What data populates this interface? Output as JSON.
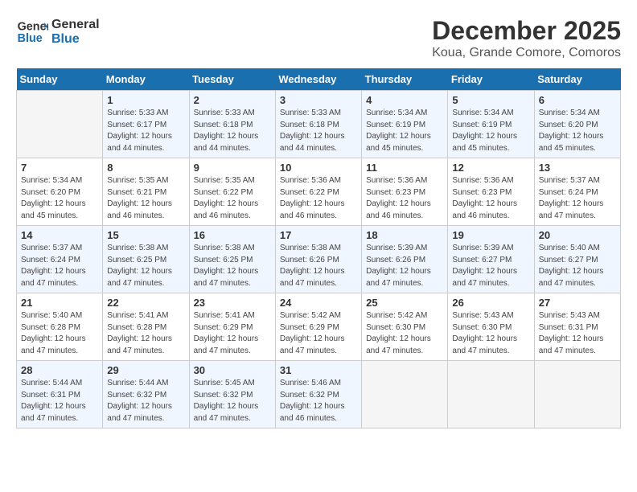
{
  "logo": {
    "line1": "General",
    "line2": "Blue"
  },
  "title": "December 2025",
  "subtitle": "Koua, Grande Comore, Comoros",
  "days_of_week": [
    "Sunday",
    "Monday",
    "Tuesday",
    "Wednesday",
    "Thursday",
    "Friday",
    "Saturday"
  ],
  "weeks": [
    [
      {
        "day": "",
        "info": ""
      },
      {
        "day": "1",
        "info": "Sunrise: 5:33 AM\nSunset: 6:17 PM\nDaylight: 12 hours\nand 44 minutes."
      },
      {
        "day": "2",
        "info": "Sunrise: 5:33 AM\nSunset: 6:18 PM\nDaylight: 12 hours\nand 44 minutes."
      },
      {
        "day": "3",
        "info": "Sunrise: 5:33 AM\nSunset: 6:18 PM\nDaylight: 12 hours\nand 44 minutes."
      },
      {
        "day": "4",
        "info": "Sunrise: 5:34 AM\nSunset: 6:19 PM\nDaylight: 12 hours\nand 45 minutes."
      },
      {
        "day": "5",
        "info": "Sunrise: 5:34 AM\nSunset: 6:19 PM\nDaylight: 12 hours\nand 45 minutes."
      },
      {
        "day": "6",
        "info": "Sunrise: 5:34 AM\nSunset: 6:20 PM\nDaylight: 12 hours\nand 45 minutes."
      }
    ],
    [
      {
        "day": "7",
        "info": "Sunrise: 5:34 AM\nSunset: 6:20 PM\nDaylight: 12 hours\nand 45 minutes."
      },
      {
        "day": "8",
        "info": "Sunrise: 5:35 AM\nSunset: 6:21 PM\nDaylight: 12 hours\nand 46 minutes."
      },
      {
        "day": "9",
        "info": "Sunrise: 5:35 AM\nSunset: 6:22 PM\nDaylight: 12 hours\nand 46 minutes."
      },
      {
        "day": "10",
        "info": "Sunrise: 5:36 AM\nSunset: 6:22 PM\nDaylight: 12 hours\nand 46 minutes."
      },
      {
        "day": "11",
        "info": "Sunrise: 5:36 AM\nSunset: 6:23 PM\nDaylight: 12 hours\nand 46 minutes."
      },
      {
        "day": "12",
        "info": "Sunrise: 5:36 AM\nSunset: 6:23 PM\nDaylight: 12 hours\nand 46 minutes."
      },
      {
        "day": "13",
        "info": "Sunrise: 5:37 AM\nSunset: 6:24 PM\nDaylight: 12 hours\nand 47 minutes."
      }
    ],
    [
      {
        "day": "14",
        "info": "Sunrise: 5:37 AM\nSunset: 6:24 PM\nDaylight: 12 hours\nand 47 minutes."
      },
      {
        "day": "15",
        "info": "Sunrise: 5:38 AM\nSunset: 6:25 PM\nDaylight: 12 hours\nand 47 minutes."
      },
      {
        "day": "16",
        "info": "Sunrise: 5:38 AM\nSunset: 6:25 PM\nDaylight: 12 hours\nand 47 minutes."
      },
      {
        "day": "17",
        "info": "Sunrise: 5:38 AM\nSunset: 6:26 PM\nDaylight: 12 hours\nand 47 minutes."
      },
      {
        "day": "18",
        "info": "Sunrise: 5:39 AM\nSunset: 6:26 PM\nDaylight: 12 hours\nand 47 minutes."
      },
      {
        "day": "19",
        "info": "Sunrise: 5:39 AM\nSunset: 6:27 PM\nDaylight: 12 hours\nand 47 minutes."
      },
      {
        "day": "20",
        "info": "Sunrise: 5:40 AM\nSunset: 6:27 PM\nDaylight: 12 hours\nand 47 minutes."
      }
    ],
    [
      {
        "day": "21",
        "info": "Sunrise: 5:40 AM\nSunset: 6:28 PM\nDaylight: 12 hours\nand 47 minutes."
      },
      {
        "day": "22",
        "info": "Sunrise: 5:41 AM\nSunset: 6:28 PM\nDaylight: 12 hours\nand 47 minutes."
      },
      {
        "day": "23",
        "info": "Sunrise: 5:41 AM\nSunset: 6:29 PM\nDaylight: 12 hours\nand 47 minutes."
      },
      {
        "day": "24",
        "info": "Sunrise: 5:42 AM\nSunset: 6:29 PM\nDaylight: 12 hours\nand 47 minutes."
      },
      {
        "day": "25",
        "info": "Sunrise: 5:42 AM\nSunset: 6:30 PM\nDaylight: 12 hours\nand 47 minutes."
      },
      {
        "day": "26",
        "info": "Sunrise: 5:43 AM\nSunset: 6:30 PM\nDaylight: 12 hours\nand 47 minutes."
      },
      {
        "day": "27",
        "info": "Sunrise: 5:43 AM\nSunset: 6:31 PM\nDaylight: 12 hours\nand 47 minutes."
      }
    ],
    [
      {
        "day": "28",
        "info": "Sunrise: 5:44 AM\nSunset: 6:31 PM\nDaylight: 12 hours\nand 47 minutes."
      },
      {
        "day": "29",
        "info": "Sunrise: 5:44 AM\nSunset: 6:32 PM\nDaylight: 12 hours\nand 47 minutes."
      },
      {
        "day": "30",
        "info": "Sunrise: 5:45 AM\nSunset: 6:32 PM\nDaylight: 12 hours\nand 47 minutes."
      },
      {
        "day": "31",
        "info": "Sunrise: 5:46 AM\nSunset: 6:32 PM\nDaylight: 12 hours\nand 46 minutes."
      },
      {
        "day": "",
        "info": ""
      },
      {
        "day": "",
        "info": ""
      },
      {
        "day": "",
        "info": ""
      }
    ]
  ]
}
